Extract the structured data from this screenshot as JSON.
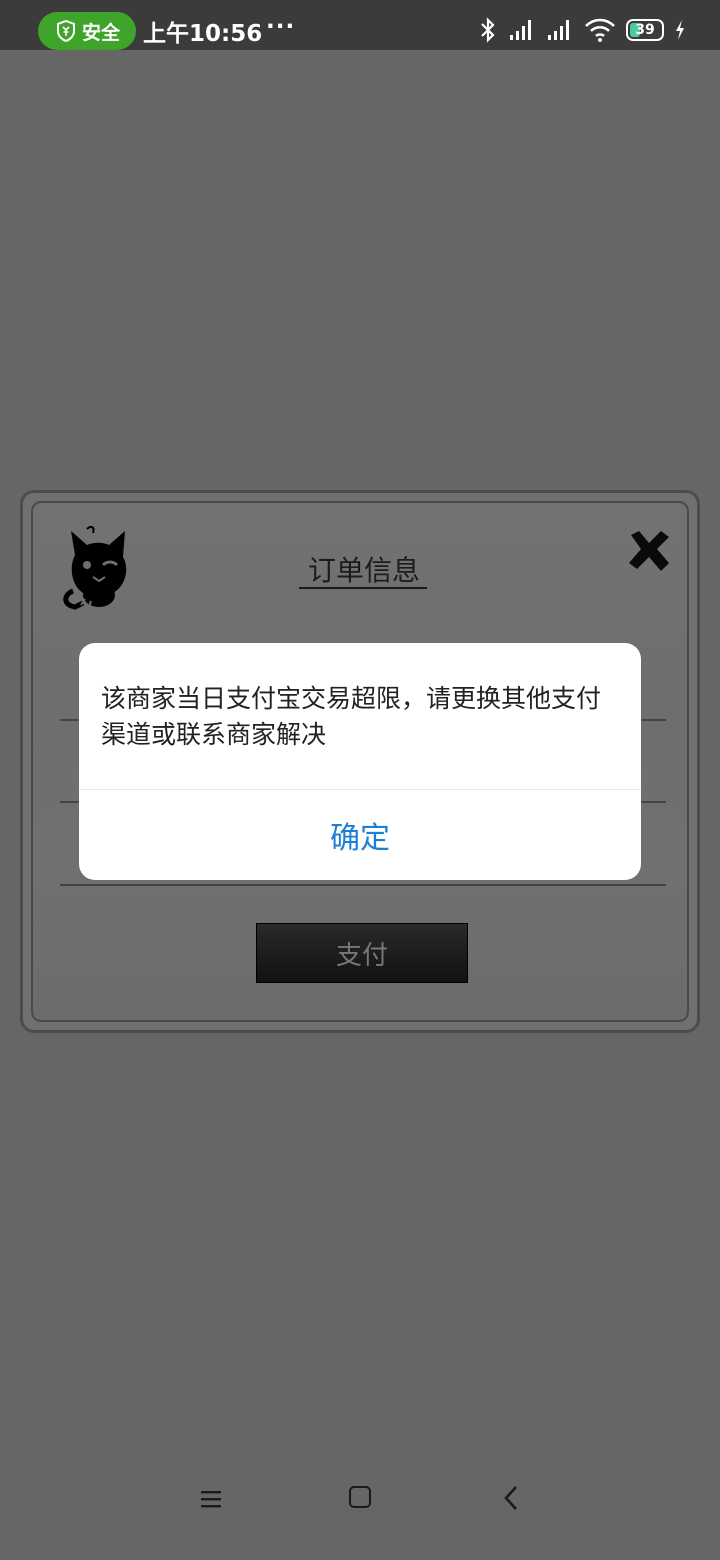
{
  "status_bar": {
    "safe_label": "安全",
    "time": "上午10:56",
    "more": "···",
    "battery_level": "39",
    "icons": [
      "shield-icon",
      "bluetooth-icon",
      "signal-icon",
      "signal-icon",
      "wifi-icon",
      "battery-icon",
      "charging-icon"
    ]
  },
  "order_panel": {
    "title": "订单信息",
    "pay_label": "支付",
    "logo": "cat-logo",
    "close_icon": "close-icon"
  },
  "dialog": {
    "message": "该商家当日支付宝交易超限，请更换其他支付渠道或联系商家解决",
    "confirm_label": "确定",
    "accent_color": "#1b7fd6"
  },
  "nav_bar": {
    "icons": [
      "menu-icon",
      "home-icon",
      "back-icon"
    ]
  }
}
